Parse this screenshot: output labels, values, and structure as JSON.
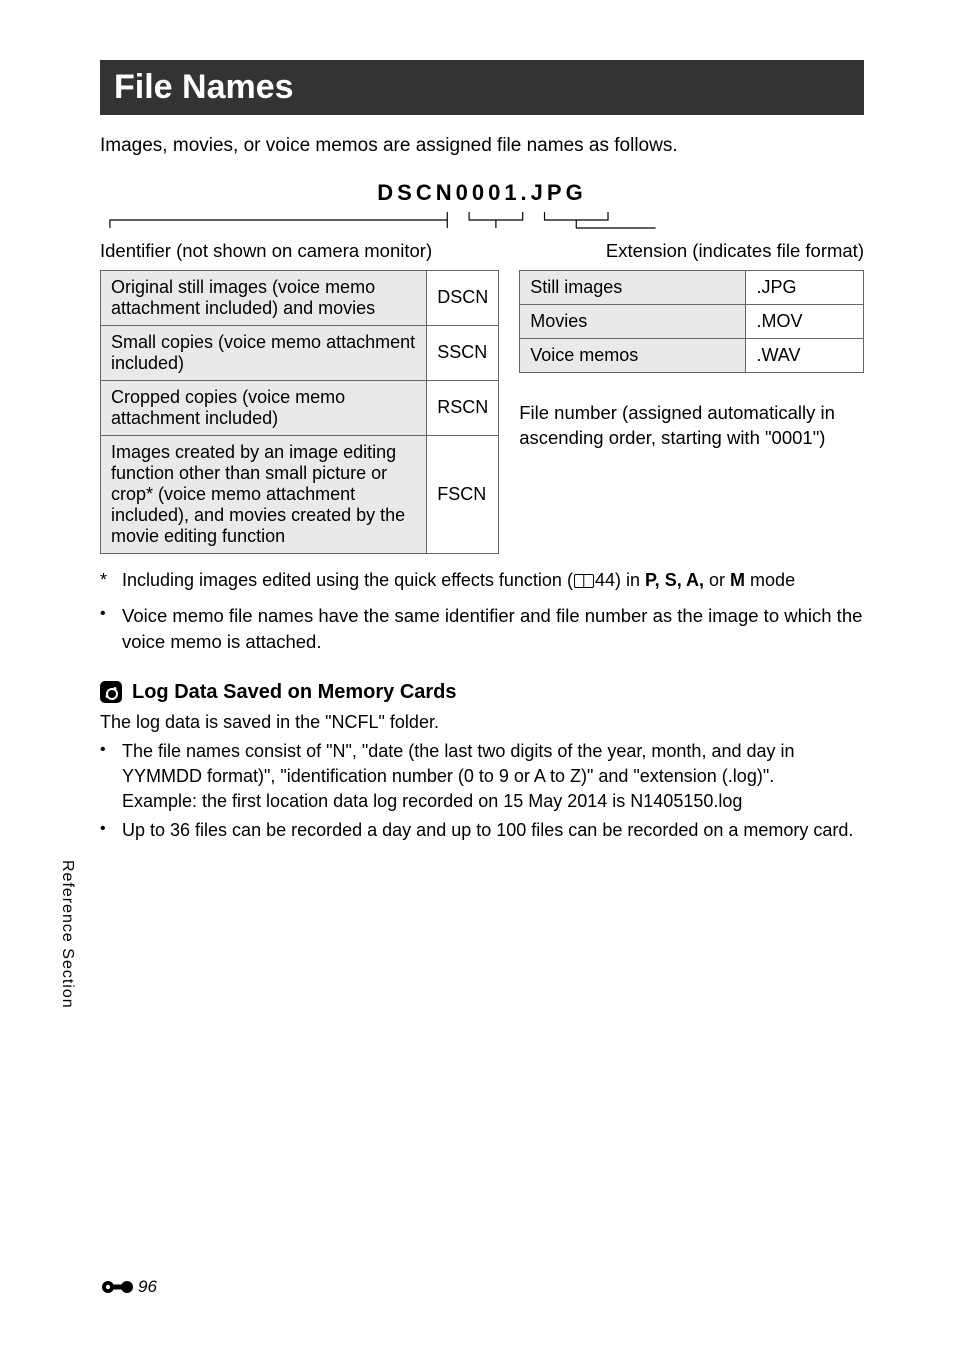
{
  "page": {
    "title": "File Names",
    "intro": "Images, movies, or voice memos are assigned file names as follows.",
    "example_filename": "DSCN0001.JPG",
    "identifier_heading": "Identifier (not shown on camera monitor)",
    "extension_heading": "Extension (indicates file format)",
    "identifier_table": [
      {
        "desc": "Original still images (voice memo attachment included) and movies",
        "code": "DSCN"
      },
      {
        "desc": "Small copies (voice memo attachment included)",
        "code": "SSCN"
      },
      {
        "desc": "Cropped copies (voice memo attachment included)",
        "code": "RSCN"
      },
      {
        "desc": "Images created by an image editing function other than small picture or crop* (voice memo attachment included), and movies created by the movie editing function",
        "code": "FSCN"
      }
    ],
    "extension_table": [
      {
        "type": "Still images",
        "ext": ".JPG"
      },
      {
        "type": "Movies",
        "ext": ".MOV"
      },
      {
        "type": "Voice memos",
        "ext": ".WAV"
      }
    ],
    "file_number_note": "File number (assigned automatically in ascending order, starting with \"0001\")",
    "footnote_symbol": "*",
    "footnote_prefix": "Including images edited using the quick effects function (",
    "footnote_ref": "44",
    "footnote_mid": ") in ",
    "footnote_modes": "P, S, A,",
    "footnote_or": " or ",
    "footnote_last_mode": "M",
    "footnote_suffix": " mode",
    "bullet_note": "Voice memo file names have the same identifier and file number as the image to which the voice memo is attached.",
    "tip_title": "Log Data Saved on Memory Cards",
    "tip_intro": "The log data is saved in the \"NCFL\" folder.",
    "tip_bullets": [
      "The file names consist of \"N\", \"date (the last two digits of the year, month, and day in YYMMDD format)\", \"identification number (0 to 9 or A to Z)\" and \"extension (.log)\".",
      "Example: the first location data log recorded on 15 May 2014 is N1405150.log",
      "Up to 36 files can be recorded a day and up to 100 files can be recorded on a memory card."
    ],
    "side_label": "Reference Section",
    "page_number": "96"
  }
}
